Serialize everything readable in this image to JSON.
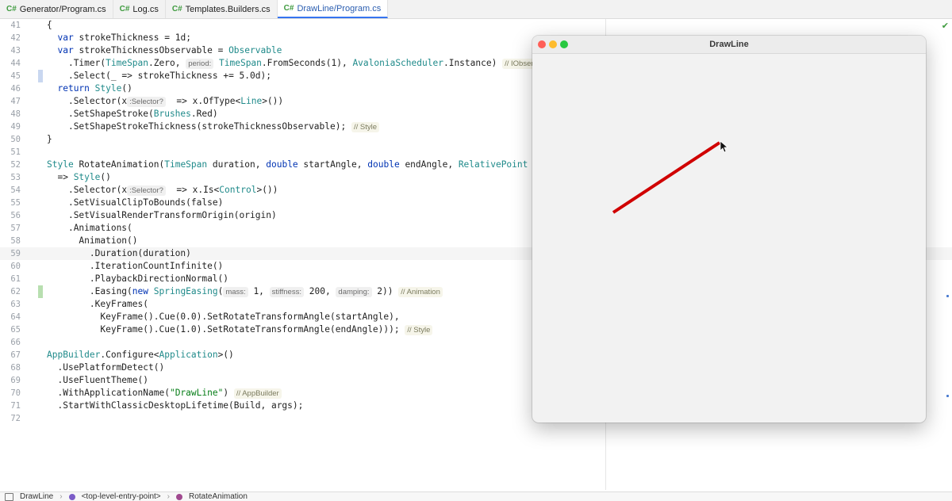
{
  "tabs": [
    {
      "name": "Generator/Program.cs",
      "active": false
    },
    {
      "name": "Log.cs",
      "active": false
    },
    {
      "name": "Templates.Builders.cs",
      "active": false
    },
    {
      "name": "DrawLine/Program.cs",
      "active": true
    }
  ],
  "cs_badge": "C#",
  "lines": [
    {
      "n": "41",
      "code": "{"
    },
    {
      "n": "42",
      "code": "  var strokeThickness = 1d;"
    },
    {
      "n": "43",
      "code": "  var strokeThicknessObservable = Observable"
    },
    {
      "n": "44",
      "code": "    .Timer(TimeSpan.Zero, ",
      "hint": "period:",
      "code2": "TimeSpan.FromSeconds(1), AvaloniaScheduler.Instance)",
      "tail": "// IObservable<long>"
    },
    {
      "n": "45",
      "code": "    .Select(_ => strokeThickness += 5.0d);"
    },
    {
      "n": "46",
      "code": "  return Style()"
    },
    {
      "n": "47",
      "code": "    .Selector(x",
      "hint": ":Selector?",
      "code2": " => x.OfType<Line>())"
    },
    {
      "n": "48",
      "code": "    .SetShapeStroke(Brushes.Red)"
    },
    {
      "n": "49",
      "code": "    .SetShapeStrokeThickness(strokeThicknessObservable);",
      "tail": "// Style"
    },
    {
      "n": "50",
      "code": "}"
    },
    {
      "n": "51",
      "code": ""
    },
    {
      "n": "52",
      "code": "Style RotateAnimation(TimeSpan duration, double startAngle, double endAngle, RelativePoint origin)"
    },
    {
      "n": "53",
      "code": "  => Style()"
    },
    {
      "n": "54",
      "code": "    .Selector(x",
      "hint": ":Selector?",
      "code2": " => x.Is<Control>())"
    },
    {
      "n": "55",
      "code": "    .SetVisualClipToBounds(false)"
    },
    {
      "n": "56",
      "code": "    .SetVisualRenderTransformOrigin(origin)"
    },
    {
      "n": "57",
      "code": "    .Animations("
    },
    {
      "n": "58",
      "code": "      Animation()"
    },
    {
      "n": "59",
      "code": "        .Duration(duration)"
    },
    {
      "n": "60",
      "code": "        .IterationCountInfinite()"
    },
    {
      "n": "61",
      "code": "        .PlaybackDirectionNormal()"
    },
    {
      "n": "62",
      "code": "        .Easing(new SpringEasing(",
      "hint": "mass:",
      "code2": "1, ",
      "hint2": "stiffness:",
      "code3": "200, ",
      "hint3": "damping:",
      "code4": "2))",
      "tail": "// Animation"
    },
    {
      "n": "63",
      "code": "        .KeyFrames("
    },
    {
      "n": "64",
      "code": "          KeyFrame().Cue(0.0).SetRotateTransformAngle(startAngle),"
    },
    {
      "n": "65",
      "code": "          KeyFrame().Cue(1.0).SetRotateTransformAngle(endAngle)));",
      "tail": "// Style"
    },
    {
      "n": "66",
      "code": ""
    },
    {
      "n": "67",
      "code": "AppBuilder.Configure<Application>()"
    },
    {
      "n": "68",
      "code": "  .UsePlatformDetect()"
    },
    {
      "n": "69",
      "code": "  .UseFluentTheme()"
    },
    {
      "n": "70",
      "code": "  .WithApplicationName(\"DrawLine\")",
      "tail": "// AppBuilder"
    },
    {
      "n": "71",
      "code": "  .StartWithClassicDesktopLifetime(Build, args);"
    },
    {
      "n": "72",
      "code": ""
    }
  ],
  "window": {
    "title": "DrawLine"
  },
  "statusbar": {
    "project": "DrawLine",
    "crumbs": [
      "<top-level-entry-point>",
      "RotateAnimation"
    ],
    "sep": "›"
  },
  "colors": {
    "line": "#d00000",
    "accent": "#3574f0",
    "traffic": [
      "#ff5f57",
      "#febc2e",
      "#28c840"
    ]
  }
}
